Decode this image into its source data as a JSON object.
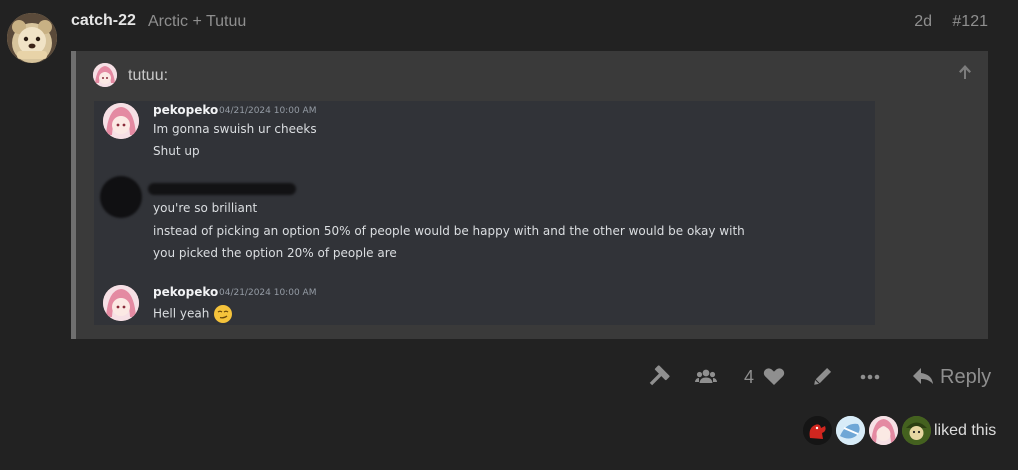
{
  "post": {
    "username": "catch-22",
    "fullname": "Arctic + Tutuu",
    "date": "2d",
    "number": "#121",
    "avatar_icon": "bear-avatar"
  },
  "quote": {
    "user": "tutuu:",
    "avatar_icon": "anime-avatar",
    "arrow_icon": "arrow-up-icon"
  },
  "discord": {
    "messages": [
      {
        "name": "pekopeko",
        "time": "04/21/2024 10:00 AM",
        "lines": [
          "Im gonna swuish ur cheeks",
          "Shut up"
        ]
      },
      {
        "name": "",
        "time": "",
        "redacted": true,
        "lines": [
          "you're so brilliant",
          "instead of picking an option 50% of people would be happy with and the other would be okay with",
          "you picked the option 20% of people are"
        ]
      },
      {
        "name": "pekopeko",
        "time": "04/21/2024 10:00 AM",
        "lines": [
          "Hell yeah"
        ],
        "emoji": "smirk-emoji"
      }
    ]
  },
  "actions": {
    "like_count": "4",
    "reply_label": "Reply",
    "icons": [
      "hammer-icon",
      "users-icon",
      "heart-icon",
      "pencil-icon",
      "ellipsis-icon",
      "reply-icon"
    ]
  },
  "liked": {
    "text": "liked this",
    "count_avatars": 4
  },
  "colors": {
    "background": "#222222",
    "quote_bg": "#3a3a3a",
    "discord_bg": "#313338",
    "muted": "#8f8f8f"
  }
}
